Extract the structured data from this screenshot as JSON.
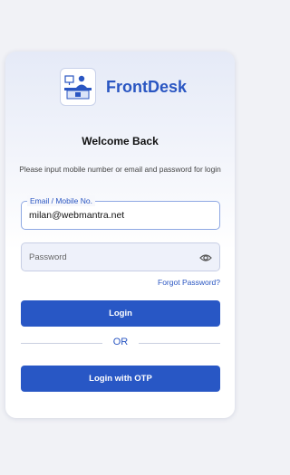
{
  "brand": {
    "name": "FrontDesk",
    "logo_icon": "receptionist-desk-icon"
  },
  "login": {
    "title": "Welcome Back",
    "instruction": "Please input mobile number or email and password for login",
    "email_label": "Email / Mobile No.",
    "email_value": "milan@webmantra.net",
    "password_placeholder": "Password",
    "forgot_password": "Forgot Password?",
    "login_button": "Login",
    "divider_text": "OR",
    "otp_button": "Login with OTP"
  },
  "colors": {
    "accent": "#2857c5",
    "background": "#f1f2f6"
  }
}
